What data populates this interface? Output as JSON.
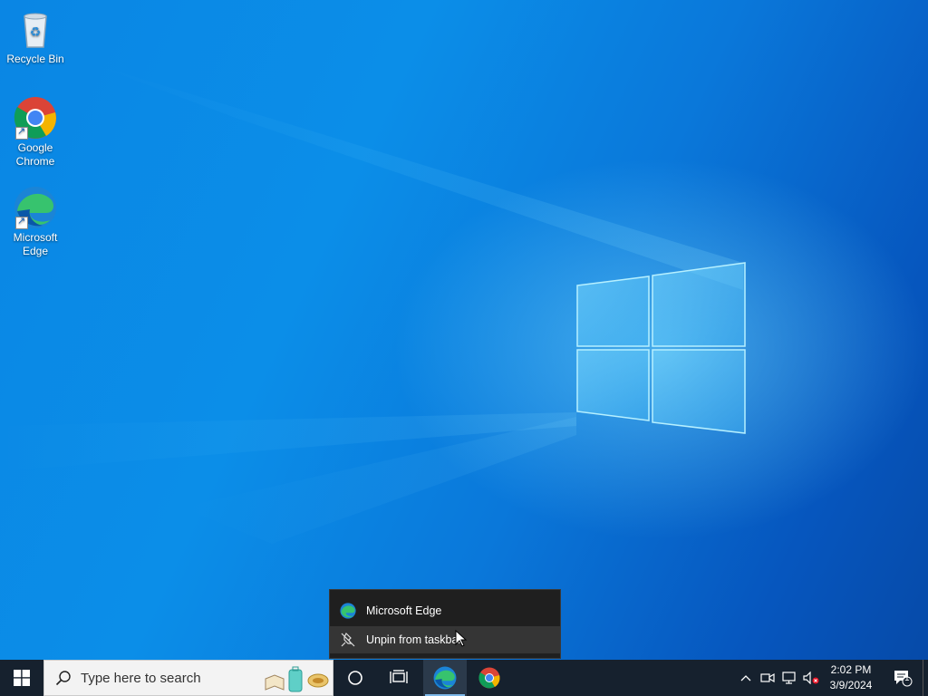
{
  "desktop": {
    "icons": [
      {
        "label": "Recycle Bin",
        "icon": "recycle-bin-icon"
      },
      {
        "label": "Google Chrome",
        "icon": "chrome-icon"
      },
      {
        "label": "Microsoft Edge",
        "icon": "edge-icon"
      }
    ]
  },
  "jumplist": {
    "app_title": "Microsoft Edge",
    "unpin_label": "Unpin from taskbar"
  },
  "taskbar": {
    "search_placeholder": "Type here to search",
    "pinned": [
      "cortana-icon",
      "task-view-icon",
      "edge-icon",
      "chrome-icon"
    ],
    "clock_time": "2:02 PM",
    "clock_date": "3/9/2024",
    "notification_count": "1"
  },
  "colors": {
    "taskbar_bg": "#16212e",
    "jumplist_bg": "#1f1f1f",
    "accent": "#0a86e4"
  }
}
